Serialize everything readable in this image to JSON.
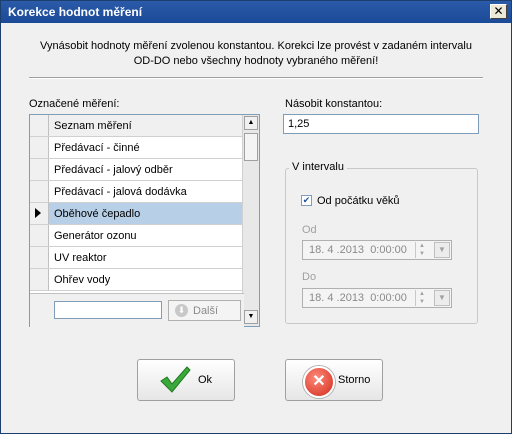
{
  "window": {
    "title": "Korekce hodnot měření",
    "close_glyph": "✕"
  },
  "description": {
    "line1": "Vynásobit hodnoty měření zvolenou konstantou. Korekci lze provést v zadaném intervalu",
    "line2": "OD-DO nebo všechny hodnoty vybraného měření!"
  },
  "measurements": {
    "label": "Označené měření:",
    "column_header": "Seznam měření",
    "rows": [
      {
        "name": "Předávací - činné",
        "selected": false
      },
      {
        "name": "Předávací - jalový odběr",
        "selected": false
      },
      {
        "name": "Předávací - jalová dodávka",
        "selected": false
      },
      {
        "name": "Oběhové čepadlo",
        "selected": true
      },
      {
        "name": "Generátor ozonu",
        "selected": false
      },
      {
        "name": "UV reaktor",
        "selected": false
      },
      {
        "name": "Ohřev vody",
        "selected": false
      }
    ],
    "search_value": "",
    "next_button": {
      "label": "Další",
      "icon": "down-arrow-circle-icon"
    }
  },
  "constant": {
    "label": "Násobit konstantou:",
    "value": "1,25"
  },
  "interval": {
    "title": "V intervalu",
    "from_start": {
      "label": "Od počátku věků",
      "checked": true,
      "check_glyph": "✔"
    },
    "from": {
      "label": "Od",
      "date": "18. 4 .2013",
      "time": "0:00:00"
    },
    "to": {
      "label": "Do",
      "date": "18. 4 .2013",
      "time": "0:00:00"
    }
  },
  "buttons": {
    "ok": {
      "label": "Ok",
      "icon": "green-checkmark-icon"
    },
    "cancel": {
      "label": "Storno",
      "icon": "red-x-icon",
      "glyph": "✕"
    }
  },
  "colors": {
    "titlebar": "#1b4a99",
    "selected_row": "#b8cfe8",
    "ok_check": "#3aa83a",
    "cancel_red": "#d22a1a"
  }
}
